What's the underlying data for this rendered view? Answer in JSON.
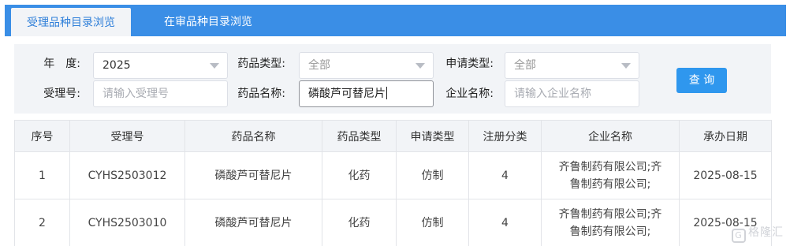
{
  "tabs": [
    {
      "label": "受理品种目录浏览"
    },
    {
      "label": "在审品种目录浏览"
    }
  ],
  "filters": {
    "year": {
      "label": "年　度:",
      "value": "2025"
    },
    "drug_type": {
      "label": "药品类型:",
      "value": "全部"
    },
    "apply_type": {
      "label": "申请类型:",
      "value": "全部"
    },
    "accept_no": {
      "label": "受理号:",
      "placeholder": "请输入受理号"
    },
    "drug_name": {
      "label": "药品名称:",
      "value": "磷酸芦可替尼片"
    },
    "company": {
      "label": "企业名称:",
      "placeholder": "请输入企业名称"
    },
    "query_button": "查 询"
  },
  "table": {
    "headers": [
      "序号",
      "受理号",
      "药品名称",
      "药品类型",
      "申请类型",
      "注册分类",
      "企业名称",
      "承办日期"
    ],
    "rows": [
      {
        "no": "1",
        "accept_no": "CYHS2503012",
        "drug_name": "磷酸芦可替尼片",
        "drug_type": "化药",
        "apply_type": "仿制",
        "reg_class": "4",
        "company": "齐鲁制药有限公司;齐鲁制药有限公司;",
        "date": "2025-08-15"
      },
      {
        "no": "2",
        "accept_no": "CYHS2503010",
        "drug_name": "磷酸芦可替尼片",
        "drug_type": "化药",
        "apply_type": "仿制",
        "reg_class": "4",
        "company": "齐鲁制药有限公司;齐鲁制药有限公司;",
        "date": "2025-08-15"
      }
    ]
  },
  "watermark": {
    "logo": "G",
    "text": "格隆汇"
  },
  "colors": {
    "tab_bar": "#3a8ee6",
    "button": "#2f97ee",
    "panel": "#f2f4f7"
  }
}
